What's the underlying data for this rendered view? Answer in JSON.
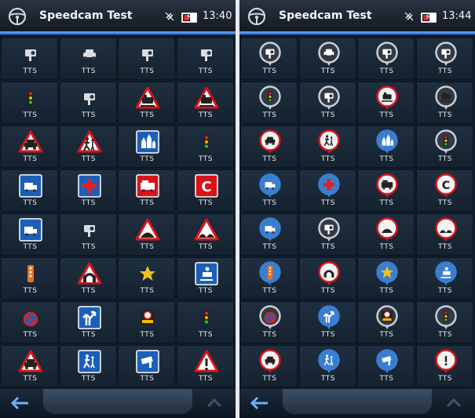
{
  "screens": [
    {
      "id": "left",
      "app_title": "Speedcam Test",
      "time": "13:40",
      "icon_style": "plain",
      "items": [
        {
          "label": "TTS",
          "icon": "fixed-speed-camera-icon"
        },
        {
          "label": "TTS",
          "icon": "police-car-icon"
        },
        {
          "label": "TTS",
          "icon": "red-light-camera-icon"
        },
        {
          "label": "TTS",
          "icon": "speed-camera-clock-icon"
        },
        {
          "label": "TTS",
          "icon": "traffic-light-icon"
        },
        {
          "label": "TTS",
          "icon": "double-camera-icon"
        },
        {
          "label": "TTS",
          "icon": "railway-crossing-warning-icon"
        },
        {
          "label": "TTS",
          "icon": "tram-warning-icon"
        },
        {
          "label": "TTS",
          "icon": "accident-warning-icon"
        },
        {
          "label": "TTS",
          "icon": "children-crossing-warning-icon"
        },
        {
          "label": "TTS",
          "icon": "town-entry-sign-icon"
        },
        {
          "label": "TTS",
          "icon": "traffic-light-speedometer-icon"
        },
        {
          "label": "TTS",
          "icon": "toll-booth-sign-icon"
        },
        {
          "label": "TTS",
          "icon": "hospital-sign-icon"
        },
        {
          "label": "TTS",
          "icon": "fire-station-sign-icon"
        },
        {
          "label": "TTS",
          "icon": "congestion-c-sign-icon"
        },
        {
          "label": "TTS",
          "icon": "truck-check-sign-icon"
        },
        {
          "label": "TTS",
          "icon": "mobile-speed-camera-icon"
        },
        {
          "label": "TTS",
          "icon": "speed-bump-warning-icon"
        },
        {
          "label": "TTS",
          "icon": "uneven-road-warning-icon"
        },
        {
          "label": "TTS",
          "icon": "speed-trailer-icon"
        },
        {
          "label": "TTS",
          "icon": "tunnel-warning-icon"
        },
        {
          "label": "TTS",
          "icon": "favorite-star-icon"
        },
        {
          "label": "TTS",
          "icon": "border-control-sign-icon"
        },
        {
          "label": "TTS",
          "icon": "no-parking-camera-icon"
        },
        {
          "label": "TTS",
          "icon": "exit-ramp-sign-icon"
        },
        {
          "label": "TTS",
          "icon": "average-speed-zone-icon"
        },
        {
          "label": "TTS",
          "icon": "traffic-light-wifi-icon"
        },
        {
          "label": "TTS",
          "icon": "car-crash-warning-icon"
        },
        {
          "label": "TTS",
          "icon": "pedestrian-crossing-sign-icon"
        },
        {
          "label": "TTS",
          "icon": "surveillance-camera-sign-icon"
        },
        {
          "label": "TTS",
          "icon": "general-danger-warning-icon"
        }
      ]
    },
    {
      "id": "right",
      "app_title": "Speedcam Test",
      "time": "13:44",
      "icon_style": "pin",
      "items": [
        {
          "label": "TTS",
          "icon": "fixed-speed-camera-pin-icon"
        },
        {
          "label": "TTS",
          "icon": "police-car-pin-icon"
        },
        {
          "label": "TTS",
          "icon": "red-light-camera-pin-icon"
        },
        {
          "label": "TTS",
          "icon": "speed-camera-clock-pin-icon"
        },
        {
          "label": "TTS",
          "icon": "traffic-light-pin-icon"
        },
        {
          "label": "TTS",
          "icon": "double-camera-pin-icon"
        },
        {
          "label": "TTS",
          "icon": "railway-crossing-pin-icon"
        },
        {
          "label": "TTS",
          "icon": "tram-pin-icon"
        },
        {
          "label": "TTS",
          "icon": "accident-pin-icon"
        },
        {
          "label": "TTS",
          "icon": "children-crossing-pin-icon"
        },
        {
          "label": "TTS",
          "icon": "town-entry-pin-icon"
        },
        {
          "label": "TTS",
          "icon": "traffic-light-speedometer-pin-icon"
        },
        {
          "label": "TTS",
          "icon": "toll-booth-pin-icon"
        },
        {
          "label": "TTS",
          "icon": "hospital-pin-icon"
        },
        {
          "label": "TTS",
          "icon": "fire-station-pin-icon"
        },
        {
          "label": "TTS",
          "icon": "congestion-c-pin-icon"
        },
        {
          "label": "TTS",
          "icon": "truck-check-pin-icon"
        },
        {
          "label": "TTS",
          "icon": "mobile-speed-camera-pin-icon"
        },
        {
          "label": "TTS",
          "icon": "speed-bump-pin-icon"
        },
        {
          "label": "TTS",
          "icon": "uneven-road-pin-icon"
        },
        {
          "label": "TTS",
          "icon": "speed-trailer-pin-icon"
        },
        {
          "label": "TTS",
          "icon": "tunnel-pin-icon"
        },
        {
          "label": "TTS",
          "icon": "favorite-star-pin-icon"
        },
        {
          "label": "TTS",
          "icon": "border-control-pin-icon"
        },
        {
          "label": "TTS",
          "icon": "no-parking-camera-pin-icon"
        },
        {
          "label": "TTS",
          "icon": "exit-ramp-pin-icon"
        },
        {
          "label": "TTS",
          "icon": "average-speed-zone-pin-icon"
        },
        {
          "label": "TTS",
          "icon": "traffic-light-wifi-pin-icon"
        },
        {
          "label": "TTS",
          "icon": "car-crash-pin-icon"
        },
        {
          "label": "TTS",
          "icon": "pedestrian-crossing-pin-icon"
        },
        {
          "label": "TTS",
          "icon": "surveillance-camera-pin-icon"
        },
        {
          "label": "TTS",
          "icon": "general-danger-pin-icon"
        }
      ]
    }
  ],
  "colors": {
    "accent": "#3f86f0",
    "danger_red": "#d8141a",
    "sign_blue": "#1c5fb8",
    "pin_blue": "#3a7ed0",
    "pin_dark": "#333a44",
    "background": "#101c2a"
  }
}
